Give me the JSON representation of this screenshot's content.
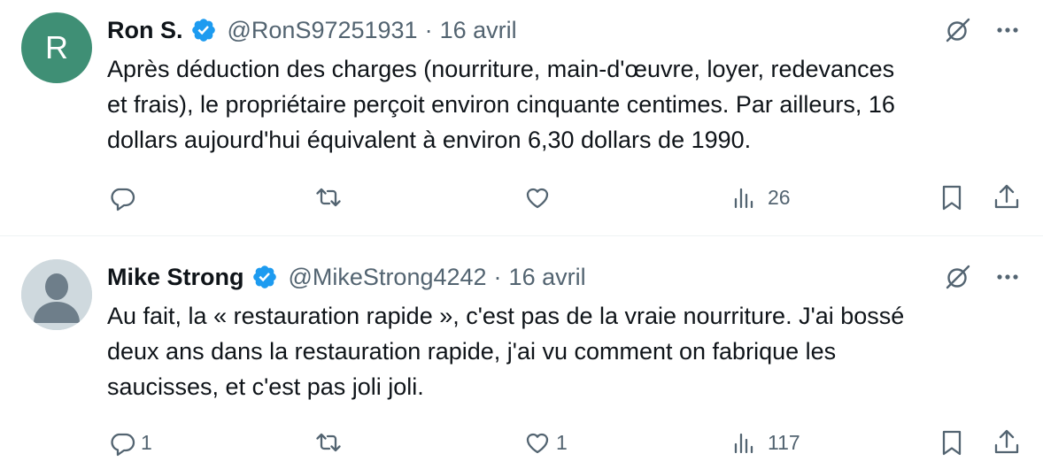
{
  "tweets": [
    {
      "avatar_letter": "R",
      "display_name": "Ron S.",
      "handle": "@RonS97251931",
      "separator": "·",
      "date": "16 avril",
      "lines": [
        "Après déduction des charges (nourriture, main-d'œuvre, loyer, redevances",
        "et frais), le propriétaire perçoit environ cinquante centimes. Par ailleurs, 16",
        "dollars aujourd'hui équivalent à environ 6,30 dollars de 1990."
      ],
      "reply_count": "",
      "retweet_count": "",
      "like_count": "",
      "view_count": "26"
    },
    {
      "avatar_letter": "",
      "display_name": "Mike Strong",
      "handle": "@MikeStrong4242",
      "separator": "·",
      "date": "16 avril",
      "lines": [
        "Au fait, la « restauration rapide », c'est pas de la vraie nourriture. J'ai bossé",
        "deux ans dans la restauration rapide, j'ai vu comment on fabrique les",
        "saucisses, et c'est pas joli joli."
      ],
      "reply_count": "1",
      "retweet_count": "",
      "like_count": "1",
      "view_count": "117"
    }
  ],
  "colors": {
    "text": "#0f1419",
    "secondary": "#536471",
    "verified": "#1d9bf0",
    "avatar_r": "#3f8f75",
    "divider": "#eff3f4"
  },
  "icons": [
    "verified-badge-icon",
    "grok-icon",
    "more-icon",
    "reply-icon",
    "retweet-icon",
    "like-icon",
    "views-icon",
    "bookmark-icon",
    "share-icon"
  ]
}
